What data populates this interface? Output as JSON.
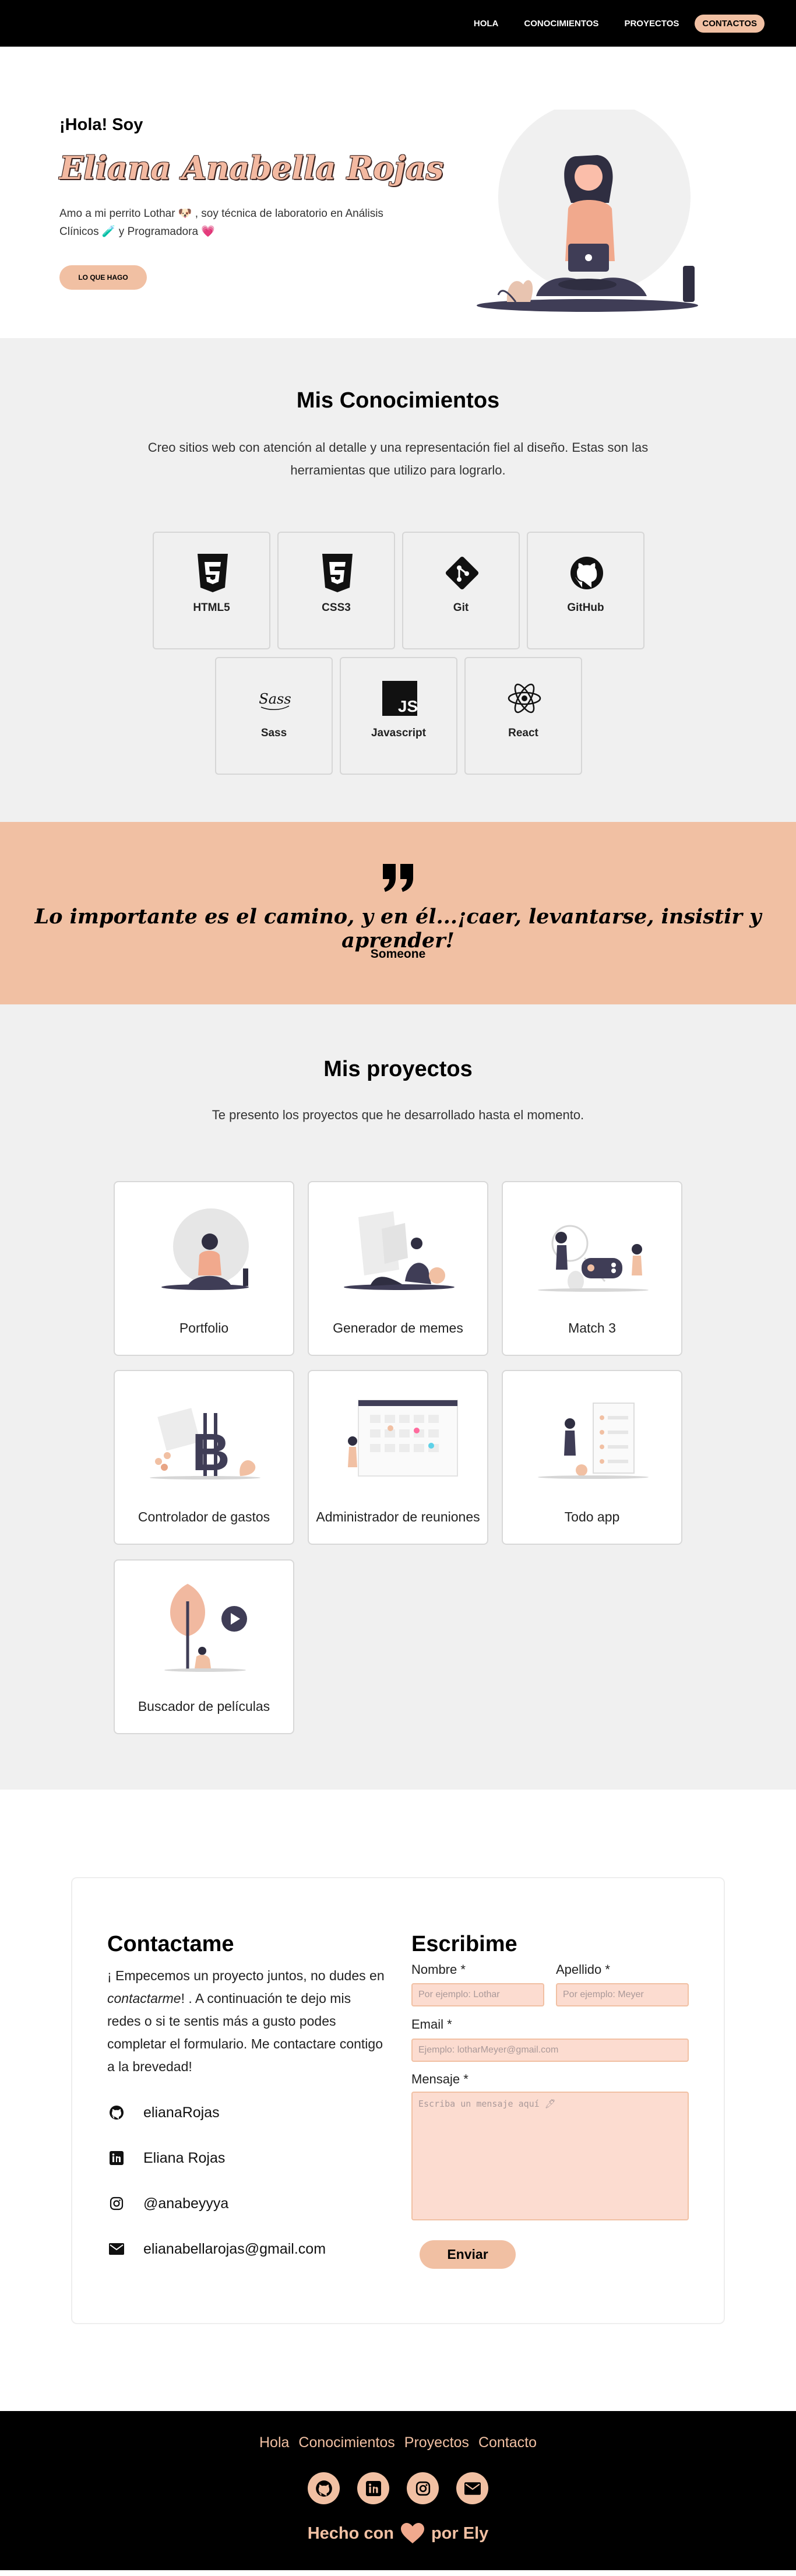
{
  "nav": {
    "items": [
      {
        "label": "HOLA"
      },
      {
        "label": "CONOCIMIENTOS"
      },
      {
        "label": "PROYECTOS"
      },
      {
        "label": "CONTACTOS"
      }
    ]
  },
  "hero": {
    "greeting": "¡Hola! Soy",
    "name": "Eliana Anabella Rojas",
    "description": "Amo a mi perrito Lothar 🐶 , soy técnica de laboratorio en Análisis Clínicos 🧪 y Programadora 💗",
    "button": "LO QUE HAGO"
  },
  "skills": {
    "title": "Mis Conocimientos",
    "subtitle": "Creo sitios web con atención al detalle y una representación fiel al diseño. Estas son las herramientas que utilizo para lograrlo.",
    "items": [
      {
        "label": "HTML5",
        "icon": "html5-icon"
      },
      {
        "label": "CSS3",
        "icon": "css3-icon"
      },
      {
        "label": "Git",
        "icon": "git-icon"
      },
      {
        "label": "GitHub",
        "icon": "github-icon"
      },
      {
        "label": "Sass",
        "icon": "sass-icon"
      },
      {
        "label": "Javascript",
        "icon": "javascript-icon"
      },
      {
        "label": "React",
        "icon": "react-icon"
      }
    ]
  },
  "quote": {
    "text": "Lo importante es el camino, y en él...¡caer, levantarse, insistir y aprender!",
    "author": "Someone"
  },
  "projects": {
    "title": "Mis proyectos",
    "subtitle": "Te presento los proyectos que he desarrollado hasta el momento.",
    "items": [
      {
        "label": "Portfolio"
      },
      {
        "label": "Generador de memes"
      },
      {
        "label": "Match 3"
      },
      {
        "label": "Controlador de gastos"
      },
      {
        "label": "Administrador de reuniones"
      },
      {
        "label": "Todo app"
      },
      {
        "label": "Buscador de películas"
      }
    ]
  },
  "contact": {
    "title": "Contactame",
    "text_before": "¡ Empecemos un proyecto juntos, no dudes en ",
    "text_em": "contactarme",
    "text_after": "! . A continuación te dejo mis redes o si te sentis más a gusto podes completar el formulario. Me contactare contigo a la brevedad!",
    "socials": [
      {
        "label": "elianaRojas",
        "icon": "github-icon"
      },
      {
        "label": "Eliana Rojas",
        "icon": "linkedin-icon"
      },
      {
        "label": "@anabeyyya",
        "icon": "instagram-icon"
      },
      {
        "label": "elianabellarojas@gmail.com",
        "icon": "envelope-icon"
      }
    ]
  },
  "form": {
    "title": "Escribime",
    "name_label": "Nombre *",
    "name_placeholder": "Por ejemplo: Lothar",
    "lastname_label": "Apellido *",
    "lastname_placeholder": "Por ejemplo: Meyer",
    "email_label": "Email *",
    "email_placeholder": "Ejemplo: lotharMeyer@gmail.com",
    "message_label": "Mensaje *",
    "message_placeholder": "Escriba un mensaje aquí 🖊",
    "submit": "Enviar"
  },
  "footer": {
    "links": [
      {
        "label": "Hola"
      },
      {
        "label": "Conocimientos"
      },
      {
        "label": "Proyectos"
      },
      {
        "label": "Contacto"
      }
    ],
    "made_before": "Hecho con",
    "made_after": "por Ely"
  },
  "colors": {
    "accent": "#f1c0a3",
    "input_bg": "#fcdcd0",
    "dark": "#3f3d56",
    "section_bg": "#f0f0f0"
  }
}
